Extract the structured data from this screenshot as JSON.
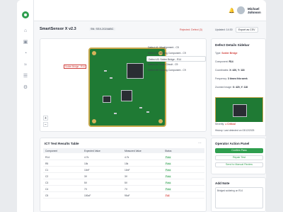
{
  "user": {
    "name": "Michael Johnson",
    "role": "Operator"
  },
  "header": {
    "device": "SmartSensor X v2.3",
    "serial": "SN: SSX-2024ABC",
    "status": "Rejected: Defect (3)",
    "updated": "Updated: 14:30",
    "export": "Export as CSV"
  },
  "defects": [
    "Defect #1: Misalignment - C5",
    "Defect #2: Missing Component - C9",
    "Defect #3: Solder Bridge - R14",
    "Defect #4: Short Circuit - C9",
    "Defect #5: Missing Component - C9"
  ],
  "marker": "Solder Bridge - R14",
  "zoom": {
    "in": "+",
    "out": "−"
  },
  "sidebar": {
    "title": "Defect Details Sidebar",
    "type_label": "Type:",
    "type_value": "Solder Bridge",
    "component_label": "Component:",
    "component_value": "R14",
    "coord_label": "Coordinates:",
    "coord_value": "X: 420, Y: 118",
    "freq_label": "Frequency:",
    "freq_value": "3 times this week",
    "zoom_label": "Zoomed Image:",
    "zoom_value": "X: 420, Y: 118",
    "severity_label": "Severity:",
    "severity_value": "Critical",
    "history_label": "History:",
    "history_value": "Last detected on 03/12/2025"
  },
  "table": {
    "title": "ICT Test Results Table",
    "columns": [
      "Component",
      "Expected Value",
      "Measured Value",
      "Status"
    ],
    "rows": [
      [
        "R14",
        "4.7k",
        "4.7k",
        "Pass"
      ],
      [
        "R5",
        "10k",
        "10k",
        "Pass"
      ],
      [
        "C1",
        "10nF",
        "10nF",
        "Pass"
      ],
      [
        "C2",
        "3V",
        "3V",
        "Pass"
      ],
      [
        "C3",
        "5V",
        "5V",
        "Pass"
      ],
      [
        "C4",
        "7V",
        "7V",
        "Pass"
      ],
      [
        "C5",
        "100uF",
        "90uF",
        "Fail"
      ]
    ]
  },
  "ops": {
    "title": "Operator Action Panel",
    "confirm": "Confirm Pass",
    "repair": "Repair Test",
    "manual": "Send to Manual Review"
  },
  "note": {
    "title": "Add Note",
    "text": "Bridged soldering on R14"
  }
}
